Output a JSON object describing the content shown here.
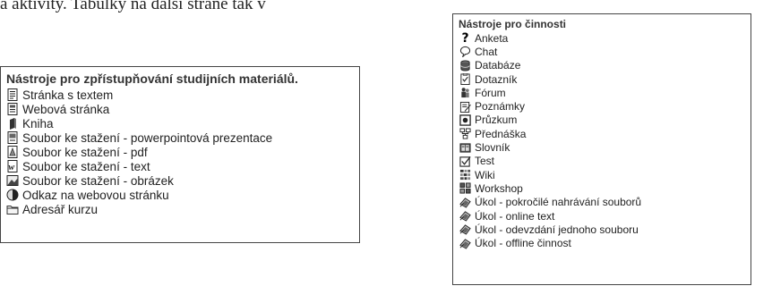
{
  "caption": "a aktivity. Tabulky na další straně tak v",
  "resources_panel": {
    "title": "Nástroje pro zpřístupňování studijních materiálů.",
    "items": [
      {
        "label": "Stránka s textem",
        "icon": "text-page-icon"
      },
      {
        "label": "Webová stránka",
        "icon": "web-page-icon"
      },
      {
        "label": "Kniha",
        "icon": "book-icon"
      },
      {
        "label": "Soubor ke stažení - powerpointová prezentace",
        "icon": "powerpoint-file-icon"
      },
      {
        "label": "Soubor ke stažení - pdf",
        "icon": "pdf-file-icon"
      },
      {
        "label": "Soubor ke stažení - text",
        "icon": "word-file-icon"
      },
      {
        "label": "Soubor ke stažení - obrázek",
        "icon": "image-file-icon"
      },
      {
        "label": "Odkaz na webovou stránku",
        "icon": "web-link-icon"
      },
      {
        "label": "Adresář kurzu",
        "icon": "folder-icon"
      }
    ]
  },
  "activities_panel": {
    "title": "Nástroje pro činnosti",
    "items": [
      {
        "label": "Anketa",
        "icon": "question-icon"
      },
      {
        "label": "Chat",
        "icon": "chat-bubble-icon"
      },
      {
        "label": "Databáze",
        "icon": "database-icon"
      },
      {
        "label": "Dotazník",
        "icon": "questionnaire-icon"
      },
      {
        "label": "Fórum",
        "icon": "forum-icon"
      },
      {
        "label": "Poznámky",
        "icon": "notes-icon"
      },
      {
        "label": "Průzkum",
        "icon": "survey-icon"
      },
      {
        "label": "Přednáška",
        "icon": "lesson-icon"
      },
      {
        "label": "Slovník",
        "icon": "glossary-icon"
      },
      {
        "label": "Test",
        "icon": "quiz-checkbox-icon"
      },
      {
        "label": "Wiki",
        "icon": "wiki-icon"
      },
      {
        "label": "Workshop",
        "icon": "workshop-icon"
      },
      {
        "label": "Úkol - pokročilé nahrávání souborů",
        "icon": "assignment-icon"
      },
      {
        "label": "Úkol - online text",
        "icon": "assignment-icon"
      },
      {
        "label": "Úkol - odevzdání jednoho souboru",
        "icon": "assignment-icon"
      },
      {
        "label": "Úkol - offline činnost",
        "icon": "assignment-icon"
      }
    ]
  }
}
